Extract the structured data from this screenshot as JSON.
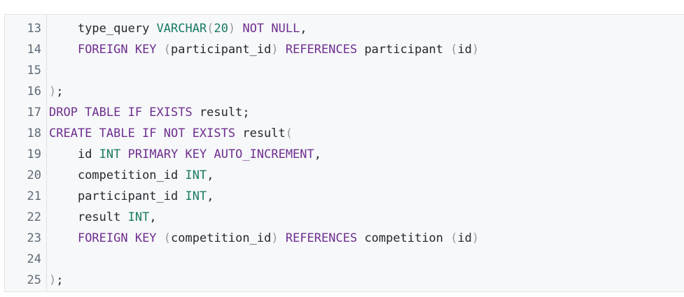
{
  "editor": {
    "lines": [
      {
        "number": "13",
        "tokens": [
          {
            "t": "    ",
            "k": "id"
          },
          {
            "t": "type_query",
            "k": "id"
          },
          {
            "t": " ",
            "k": "id"
          },
          {
            "t": "VARCHAR",
            "k": "ty"
          },
          {
            "t": "(",
            "k": "pn"
          },
          {
            "t": "20",
            "k": "ty"
          },
          {
            "t": ")",
            "k": "pn"
          },
          {
            "t": " ",
            "k": "id"
          },
          {
            "t": "NOT NULL",
            "k": "kw"
          },
          {
            "t": ",",
            "k": "id"
          }
        ]
      },
      {
        "number": "14",
        "tokens": [
          {
            "t": "    ",
            "k": "id"
          },
          {
            "t": "FOREIGN KEY",
            "k": "kw"
          },
          {
            "t": " ",
            "k": "id"
          },
          {
            "t": "(",
            "k": "pn"
          },
          {
            "t": "participant_id",
            "k": "id"
          },
          {
            "t": ")",
            "k": "pn"
          },
          {
            "t": " ",
            "k": "id"
          },
          {
            "t": "REFERENCES",
            "k": "kw"
          },
          {
            "t": " participant ",
            "k": "id"
          },
          {
            "t": "(",
            "k": "pn"
          },
          {
            "t": "id",
            "k": "id"
          },
          {
            "t": ")",
            "k": "pn"
          }
        ]
      },
      {
        "number": "15",
        "tokens": []
      },
      {
        "number": "16",
        "tokens": [
          {
            "t": ")",
            "k": "pn"
          },
          {
            "t": ";",
            "k": "id"
          }
        ]
      },
      {
        "number": "17",
        "tokens": [
          {
            "t": "DROP TABLE IF EXISTS",
            "k": "kw"
          },
          {
            "t": " result;",
            "k": "id"
          }
        ]
      },
      {
        "number": "18",
        "tokens": [
          {
            "t": "CREATE TABLE IF NOT EXISTS",
            "k": "kw"
          },
          {
            "t": " result",
            "k": "id"
          },
          {
            "t": "(",
            "k": "pn"
          }
        ]
      },
      {
        "number": "19",
        "tokens": [
          {
            "t": "    ",
            "k": "id"
          },
          {
            "t": "id",
            "k": "id"
          },
          {
            "t": " ",
            "k": "id"
          },
          {
            "t": "INT",
            "k": "ty"
          },
          {
            "t": " ",
            "k": "id"
          },
          {
            "t": "PRIMARY KEY AUTO_INCREMENT",
            "k": "kw"
          },
          {
            "t": ",",
            "k": "id"
          }
        ]
      },
      {
        "number": "20",
        "tokens": [
          {
            "t": "    ",
            "k": "id"
          },
          {
            "t": "competition_id",
            "k": "id"
          },
          {
            "t": " ",
            "k": "id"
          },
          {
            "t": "INT",
            "k": "ty"
          },
          {
            "t": ",",
            "k": "id"
          }
        ]
      },
      {
        "number": "21",
        "tokens": [
          {
            "t": "    ",
            "k": "id"
          },
          {
            "t": "participant_id",
            "k": "id"
          },
          {
            "t": " ",
            "k": "id"
          },
          {
            "t": "INT",
            "k": "ty"
          },
          {
            "t": ",",
            "k": "id"
          }
        ]
      },
      {
        "number": "22",
        "tokens": [
          {
            "t": "    ",
            "k": "id"
          },
          {
            "t": "result",
            "k": "id"
          },
          {
            "t": " ",
            "k": "id"
          },
          {
            "t": "INT",
            "k": "ty"
          },
          {
            "t": ",",
            "k": "id"
          }
        ]
      },
      {
        "number": "23",
        "tokens": [
          {
            "t": "    ",
            "k": "id"
          },
          {
            "t": "FOREIGN KEY",
            "k": "kw"
          },
          {
            "t": " ",
            "k": "id"
          },
          {
            "t": "(",
            "k": "pn"
          },
          {
            "t": "competition_id",
            "k": "id"
          },
          {
            "t": ")",
            "k": "pn"
          },
          {
            "t": " ",
            "k": "id"
          },
          {
            "t": "REFERENCES",
            "k": "kw"
          },
          {
            "t": " competition ",
            "k": "id"
          },
          {
            "t": "(",
            "k": "pn"
          },
          {
            "t": "id",
            "k": "id"
          },
          {
            "t": ")",
            "k": "pn"
          }
        ]
      },
      {
        "number": "24",
        "tokens": []
      },
      {
        "number": "25",
        "tokens": [
          {
            "t": ")",
            "k": "pn"
          },
          {
            "t": ";",
            "k": "id"
          }
        ]
      }
    ]
  },
  "colors": {
    "keyword": "#6f2e8e",
    "type": "#1a7a63",
    "punctuation": "#9a9a9a",
    "identifier": "#24292e",
    "line_number": "#5f6a75",
    "background": "#f6f8fa"
  }
}
